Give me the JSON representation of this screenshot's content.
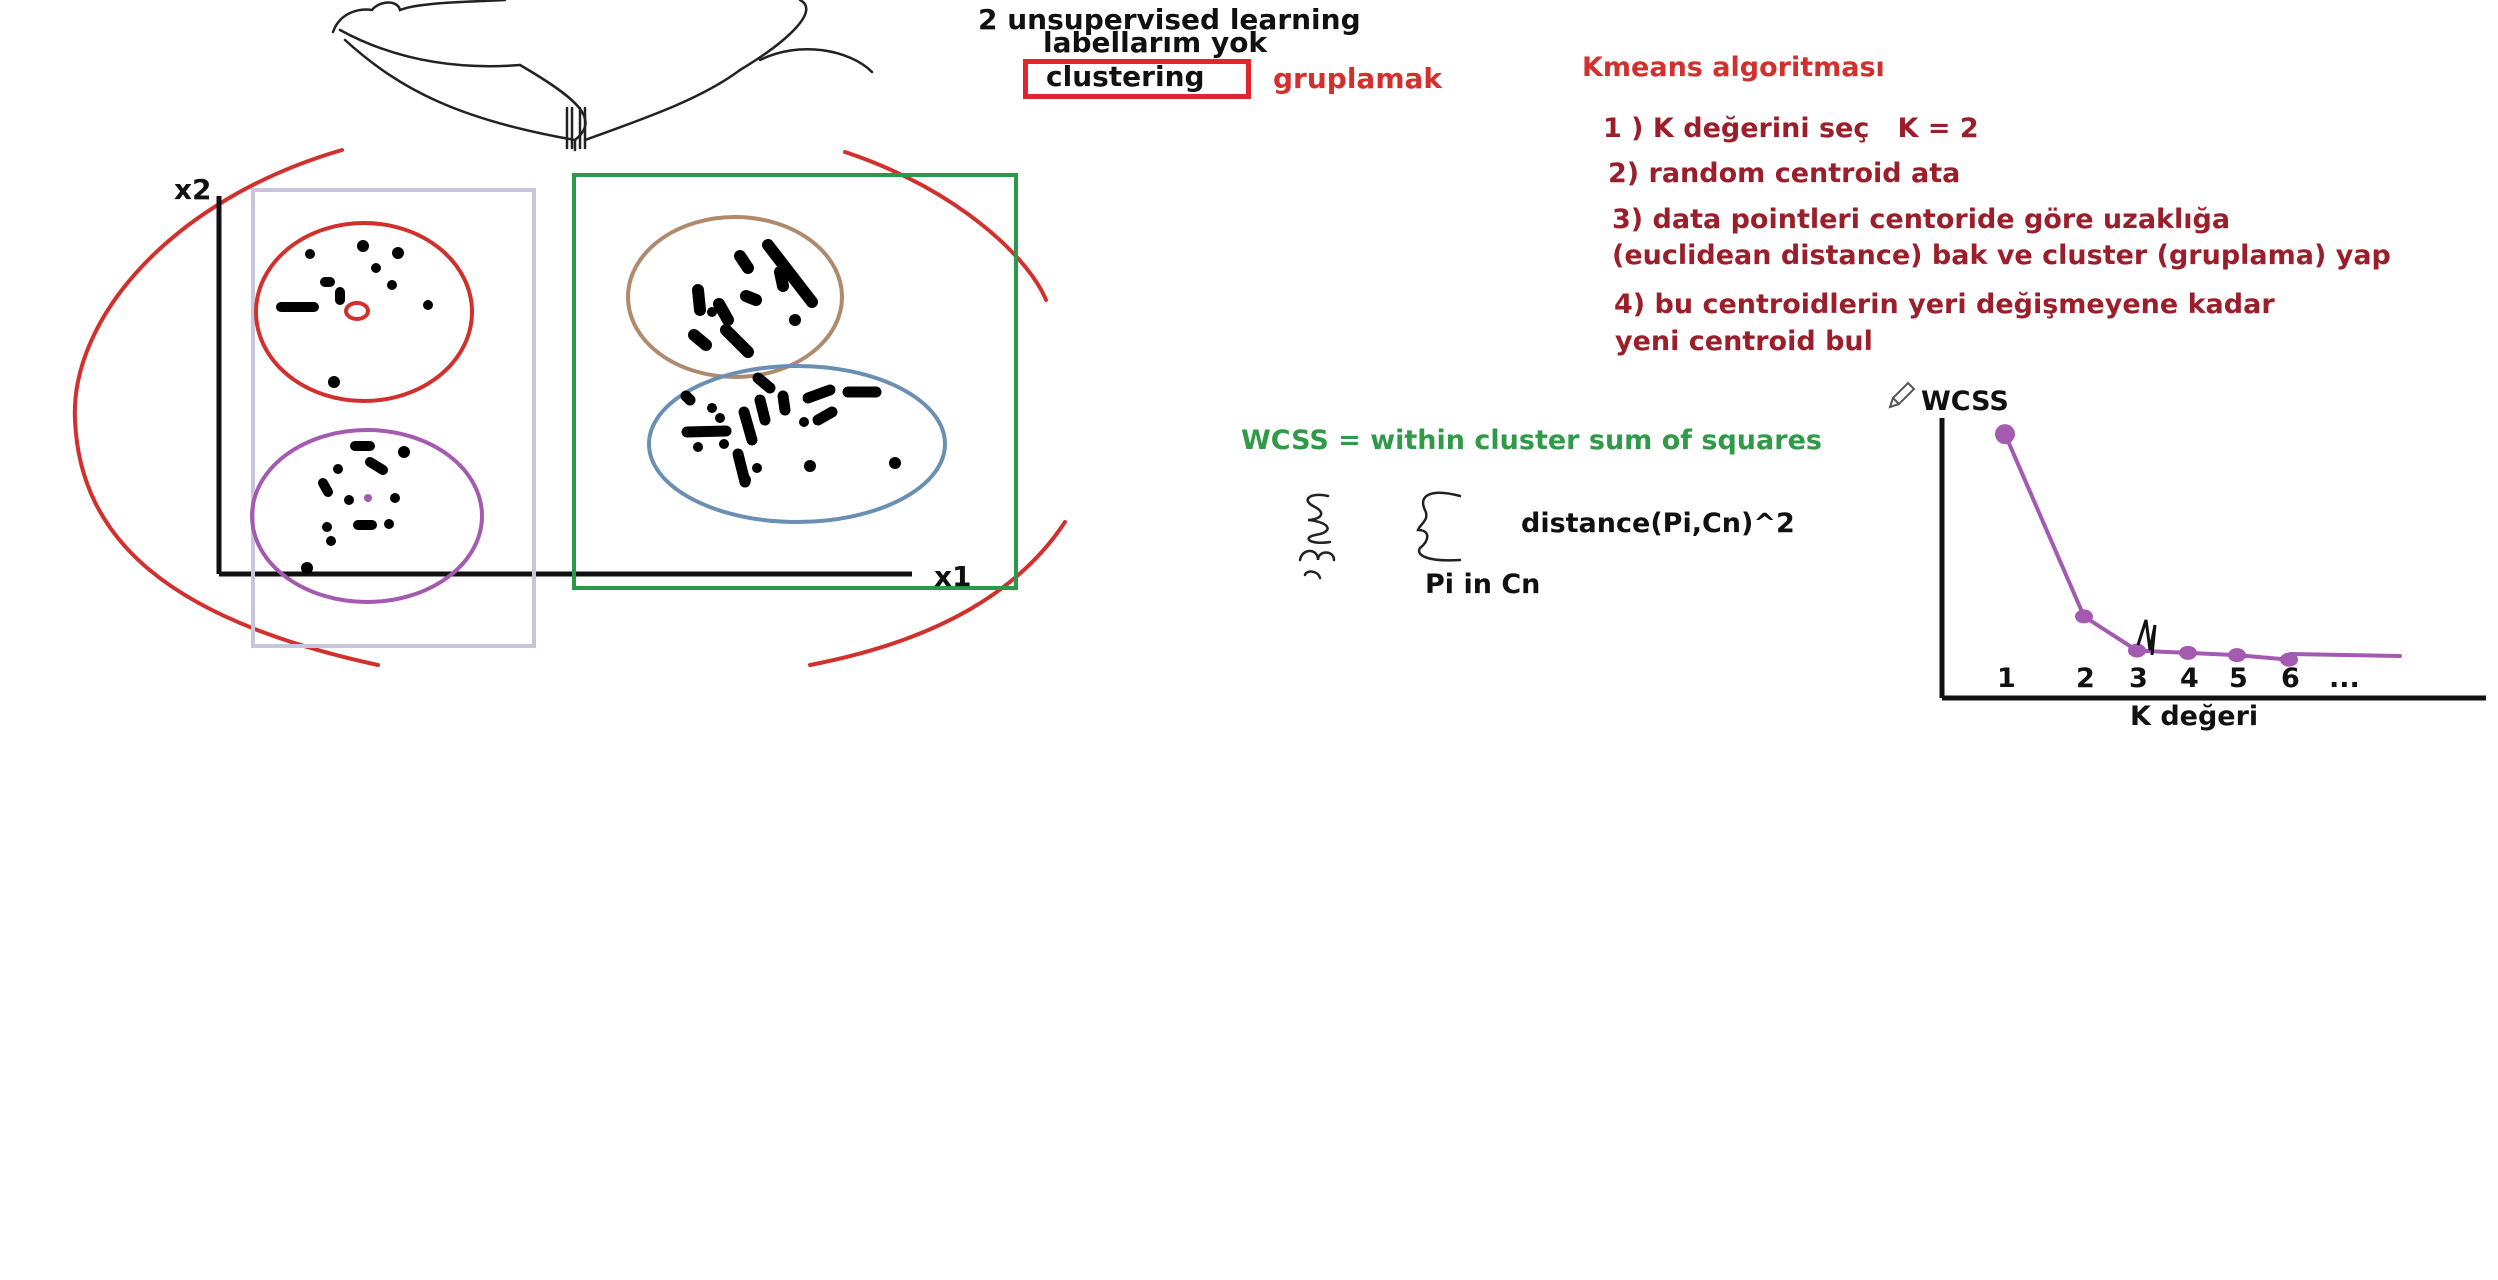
{
  "header": {
    "line1": "2 unsupervised learning",
    "line2": "labellarım yok",
    "boxed_word": "clustering",
    "gruplamak": "gruplamak"
  },
  "scatter": {
    "x_axis_label": "x1",
    "y_axis_label": "x2"
  },
  "kmeans": {
    "title": "Kmeans algoritması",
    "steps": [
      "1 ) K değerini seç   K = 2",
      "2) random centroid ata",
      "3) data pointleri centoride göre uzaklığa",
      "(euclidean distance) bak ve cluster (gruplama) yap",
      "4) bu centroidlerin yeri değişmeyene kadar",
      "yeni centroid bul"
    ]
  },
  "wcss": {
    "definition": "WCSS = within cluster sum of squares",
    "formula": "distance(Pi,Cn)^2",
    "subscript": "Pi in Cn"
  },
  "chart_data": {
    "type": "line",
    "title": "",
    "ylabel": "WCSS",
    "xlabel": "K değeri",
    "tick_labels": [
      "1",
      "2",
      "3",
      "4",
      "5",
      "6",
      "..."
    ],
    "x": [
      1,
      2,
      3,
      4,
      5,
      6
    ],
    "values": [
      100,
      20,
      5,
      4,
      3,
      1
    ],
    "ylim": [
      0,
      110
    ],
    "grid": false,
    "series_color": "#a35ab0"
  },
  "colors": {
    "red": "#d2302d",
    "darkred": "#9b1f2b",
    "green": "#2f9a48",
    "purple": "#a35ab0",
    "brown": "#b08a6c",
    "steel_blue": "#6a8fb3",
    "lavender": "#c8c4dc",
    "frame_green": "#2a9a4a"
  }
}
